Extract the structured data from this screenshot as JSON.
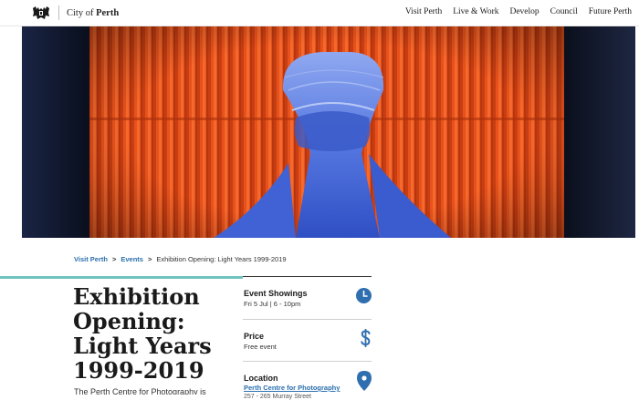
{
  "header": {
    "logo_prefix": "City of",
    "logo_city": "Perth",
    "nav": [
      {
        "label": "Visit Perth"
      },
      {
        "label": "Live & Work"
      },
      {
        "label": "Develop"
      },
      {
        "label": "Council"
      },
      {
        "label": "Future Perth"
      }
    ]
  },
  "breadcrumb": {
    "items": [
      {
        "label": "Visit Perth"
      },
      {
        "label": "Events"
      }
    ],
    "separator": ">",
    "current": "Exhibition Opening: Light Years 1999-2019"
  },
  "event": {
    "title": "Exhibition Opening: Light Years 1999-2019",
    "intro": "The Perth Centre for Photography is"
  },
  "details": {
    "showings": {
      "heading": "Event Showings",
      "value": "Fri 5 Jul | 6 - 10pm"
    },
    "price": {
      "heading": "Price",
      "value": "Free event"
    },
    "location": {
      "heading": "Location",
      "link": "Perth Centre for Photography",
      "address": "257 - 265 Murray Street"
    }
  },
  "colors": {
    "accent_teal": "#6cc3c0",
    "link_blue": "#2a6fae",
    "icon_blue": "#2f6fb0",
    "hero_orange": "#e8511c",
    "hero_blue": "#3a5fd0"
  },
  "icons": {
    "crest": "city-crest-icon",
    "clock": "clock-icon",
    "dollar": "dollar-icon",
    "location": "map-pin-icon"
  }
}
